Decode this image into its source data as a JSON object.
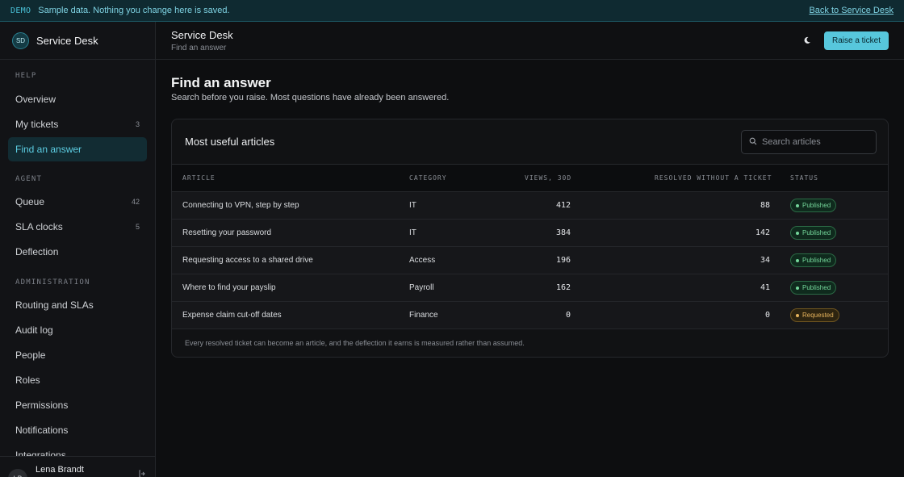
{
  "banner": {
    "tag": "DEMO",
    "message": "Sample data. Nothing you change here is saved.",
    "back_link": "Back to Service Desk"
  },
  "brand": {
    "initials": "SD",
    "name": "Service Desk"
  },
  "sidebar": {
    "sections": [
      {
        "label": "HELP",
        "items": [
          {
            "label": "Overview",
            "count": ""
          },
          {
            "label": "My tickets",
            "count": "3"
          },
          {
            "label": "Find an answer",
            "count": "",
            "active": true
          }
        ]
      },
      {
        "label": "AGENT",
        "items": [
          {
            "label": "Queue",
            "count": "42"
          },
          {
            "label": "SLA clocks",
            "count": "5"
          },
          {
            "label": "Deflection",
            "count": ""
          }
        ]
      },
      {
        "label": "ADMINISTRATION",
        "items": [
          {
            "label": "Routing and SLAs",
            "count": ""
          },
          {
            "label": "Audit log",
            "count": ""
          },
          {
            "label": "People",
            "count": ""
          },
          {
            "label": "Roles",
            "count": ""
          },
          {
            "label": "Permissions",
            "count": ""
          },
          {
            "label": "Notifications",
            "count": ""
          },
          {
            "label": "Integrations",
            "count": ""
          }
        ]
      }
    ]
  },
  "user": {
    "initials": "LB",
    "name": "Lena Brandt"
  },
  "topbar": {
    "title": "Service Desk",
    "subtitle": "Find an answer",
    "theme_icon": "moon-icon",
    "raise_label": "Raise a ticket"
  },
  "page": {
    "title": "Find an answer",
    "subtitle": "Search before you raise. Most questions have already been answered."
  },
  "articles": {
    "title": "Most useful articles",
    "search_placeholder": "Search articles",
    "columns": [
      "ARTICLE",
      "CATEGORY",
      "VIEWS, 30D",
      "RESOLVED WITHOUT A TICKET",
      "STATUS"
    ],
    "rows": [
      {
        "article": "Connecting to VPN, step by step",
        "category": "IT",
        "views": "412",
        "resolved": "88",
        "status": "Published"
      },
      {
        "article": "Resetting your password",
        "category": "IT",
        "views": "384",
        "resolved": "142",
        "status": "Published"
      },
      {
        "article": "Requesting access to a shared drive",
        "category": "Access",
        "views": "196",
        "resolved": "34",
        "status": "Published"
      },
      {
        "article": "Where to find your payslip",
        "category": "Payroll",
        "views": "162",
        "resolved": "41",
        "status": "Published"
      },
      {
        "article": "Expense claim cut-off dates",
        "category": "Finance",
        "views": "0",
        "resolved": "0",
        "status": "Requested"
      }
    ],
    "footnote": "Every resolved ticket can become an article, and the deflection it earns is measured rather than assumed."
  },
  "colors": {
    "accent": "#57c7dc",
    "published": "#74d69a",
    "requested": "#e6b35c"
  }
}
